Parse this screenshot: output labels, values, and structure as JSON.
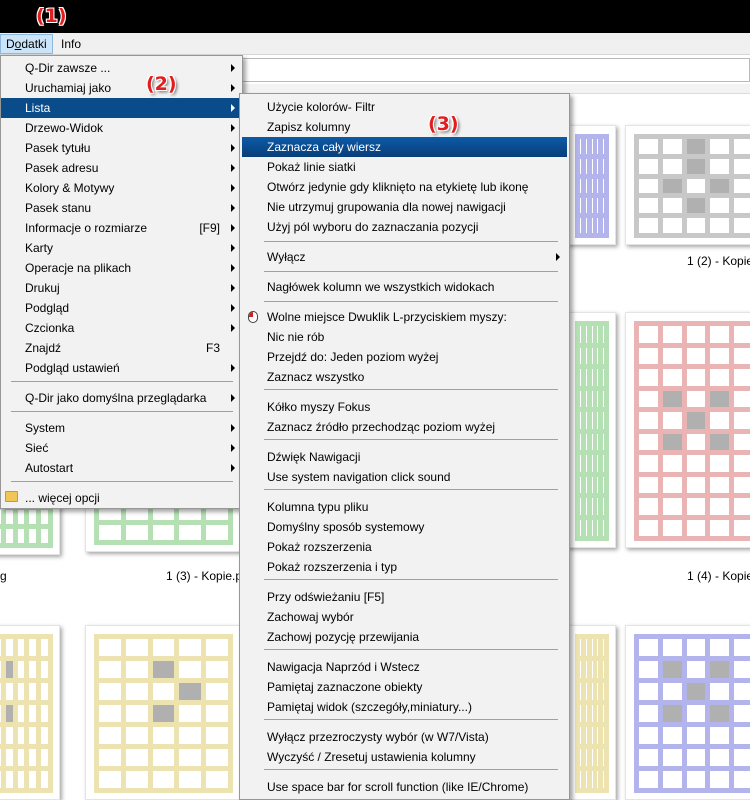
{
  "menubar": {
    "dodatki_prefix": "D",
    "dodatki_underlined": "o",
    "dodatki_rest": "datki",
    "info": "Info"
  },
  "annotations": [
    "(1)",
    "(2)",
    "(3)"
  ],
  "thumbnails": {
    "captions": [
      "1 (2) - Kopie",
      "g",
      "1 (3) - Kopie.p",
      "1 (4) - Kopie"
    ],
    "colors": {
      "gray": "#c8c8c8",
      "pink": "#ebb4b4",
      "green": "#b4e0b4",
      "yellow": "#ece3b0",
      "blue": "#b4b4ec",
      "dark_cell": "#b0b0b0"
    }
  },
  "main_menu": {
    "items": [
      {
        "label": "Q-Dir zawsze ...",
        "submenu": true
      },
      {
        "label": "Uruchamiaj jako",
        "submenu": true
      },
      {
        "label": "Lista",
        "submenu": true,
        "highlighted": true
      },
      {
        "label": "Drzewo-Widok",
        "submenu": true
      },
      {
        "label": "Pasek tytułu",
        "submenu": true
      },
      {
        "label": "Pasek adresu",
        "submenu": true
      },
      {
        "label": "Kolory & Motywy",
        "submenu": true
      },
      {
        "label": "Pasek stanu",
        "submenu": true
      },
      {
        "label": "Informacje o rozmiarze",
        "shortcut": "[F9]",
        "submenu": true
      },
      {
        "label": "Karty",
        "submenu": true
      },
      {
        "label": "Operacje na plikach",
        "submenu": true
      },
      {
        "label": "Drukuj",
        "submenu": true
      },
      {
        "label": "Podgląd",
        "submenu": true
      },
      {
        "label": "Czcionka",
        "submenu": true
      },
      {
        "label": "Znajdź",
        "shortcut": "F3",
        "submenu": false
      },
      {
        "label": "Podgląd ustawień",
        "submenu": true
      },
      {
        "label": "Q-Dir jako domyślna przeglądarka",
        "submenu": true
      },
      {
        "label": "System",
        "submenu": true
      },
      {
        "label": "Sieć",
        "submenu": true
      },
      {
        "label": "Autostart",
        "submenu": true
      },
      {
        "label": "... więcej opcji",
        "submenu": false,
        "icon": "folder-icon"
      }
    ]
  },
  "sub_menu": {
    "items": [
      {
        "label": "Użycie kolorów- Filtr"
      },
      {
        "label": "Zapisz kolumny"
      },
      {
        "label": "Zaznacza cały wiersz",
        "highlighted": true
      },
      {
        "label": "Pokaż linie siatki"
      },
      {
        "label": "Otwórz jedynie gdy kliknięto na etykietę lub ikonę"
      },
      {
        "label": "Nie utrzymuj grupowania dla nowej nawigacji"
      },
      {
        "label": "Użyj pól wyboru do zaznaczania pozycji"
      },
      {
        "label": "Wyłącz",
        "submenu": true
      },
      {
        "label": "Nagłówek kolumn we wszystkich widokach"
      },
      {
        "label": "Wolne miejsce Dwuklik L-przyciskiem myszy:",
        "icon": "mouse-icon"
      },
      {
        "label": "Nic nie rób"
      },
      {
        "label": "Przejdź do: Jeden poziom wyżej"
      },
      {
        "label": "Zaznacz wszystko"
      },
      {
        "label": "Kółko myszy Fokus"
      },
      {
        "label": "Zaznacz źródło przechodząc poziom wyżej"
      },
      {
        "label": "Dźwięk Nawigacji"
      },
      {
        "label": "Use system navigation click sound"
      },
      {
        "label": "Kolumna typu pliku"
      },
      {
        "label": "Domyślny sposób systemowy"
      },
      {
        "label": "Pokaż rozszerzenia"
      },
      {
        "label": "Pokaż rozszerzenia i typ"
      },
      {
        "label": "Przy odświeżaniu [F5]"
      },
      {
        "label": "Zachowaj wybór"
      },
      {
        "label": "Zachowj pozycję przewijania"
      },
      {
        "label": "Nawigacja Naprzód i Wstecz"
      },
      {
        "label": "Pamiętaj zaznaczone obiekty"
      },
      {
        "label": "Pamiętaj widok (szczegóły,miniatury...)"
      },
      {
        "label": "Wyłącz przezroczysty wybór (w W7/Vista)"
      },
      {
        "label": "Wyczyść / Zresetuj ustawienia kolumny"
      },
      {
        "label": "Use space bar for scroll function (like IE/Chrome)"
      }
    ]
  }
}
